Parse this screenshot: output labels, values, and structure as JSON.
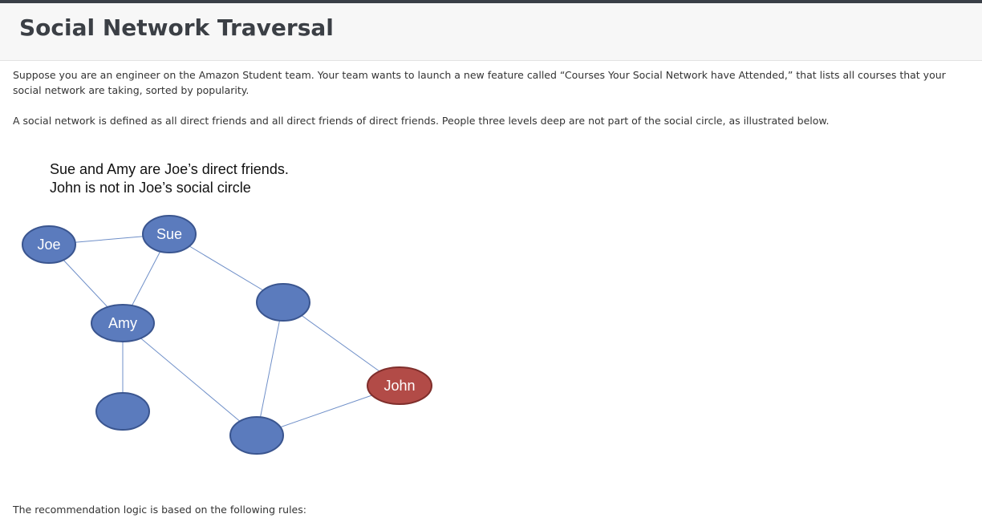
{
  "header": {
    "title": "Social Network Traversal"
  },
  "body": {
    "paragraph_1": "Suppose you are an engineer on the Amazon Student team.  Your team wants to launch a new feature called “Courses Your Social Network have Attended,” that lists all courses that your social network are taking, sorted by popularity.",
    "paragraph_2": "A social network is defined as all direct friends and all direct friends of direct friends.  People three levels deep are not part of the social circle, as illustrated below.",
    "paragraph_3": "The recommendation logic is based on the following rules:"
  },
  "diagram": {
    "caption_line_1": "Sue and Amy are Joe’s direct friends.",
    "caption_line_2": "John is not in Joe’s social circle",
    "colors": {
      "node_fill": "#5b7bbd",
      "node_stroke": "#3a558f",
      "excluded_fill": "#b24b47",
      "excluded_stroke": "#7f2e2b",
      "edge": "#6f8fc8"
    },
    "nodes": [
      {
        "id": "joe",
        "label": "Joe",
        "status": "self"
      },
      {
        "id": "sue",
        "label": "Sue",
        "status": "direct-friend"
      },
      {
        "id": "amy",
        "label": "Amy",
        "status": "direct-friend"
      },
      {
        "id": "n4",
        "label": "",
        "status": "friend-of-friend"
      },
      {
        "id": "n5",
        "label": "",
        "status": "friend-of-friend"
      },
      {
        "id": "n6",
        "label": "",
        "status": "friend-of-friend"
      },
      {
        "id": "john",
        "label": "John",
        "status": "excluded"
      }
    ],
    "edges": [
      [
        "joe",
        "sue"
      ],
      [
        "joe",
        "amy"
      ],
      [
        "sue",
        "amy"
      ],
      [
        "sue",
        "n4"
      ],
      [
        "amy",
        "n5"
      ],
      [
        "amy",
        "n6"
      ],
      [
        "n4",
        "n6"
      ],
      [
        "n4",
        "john"
      ],
      [
        "n6",
        "john"
      ]
    ]
  }
}
